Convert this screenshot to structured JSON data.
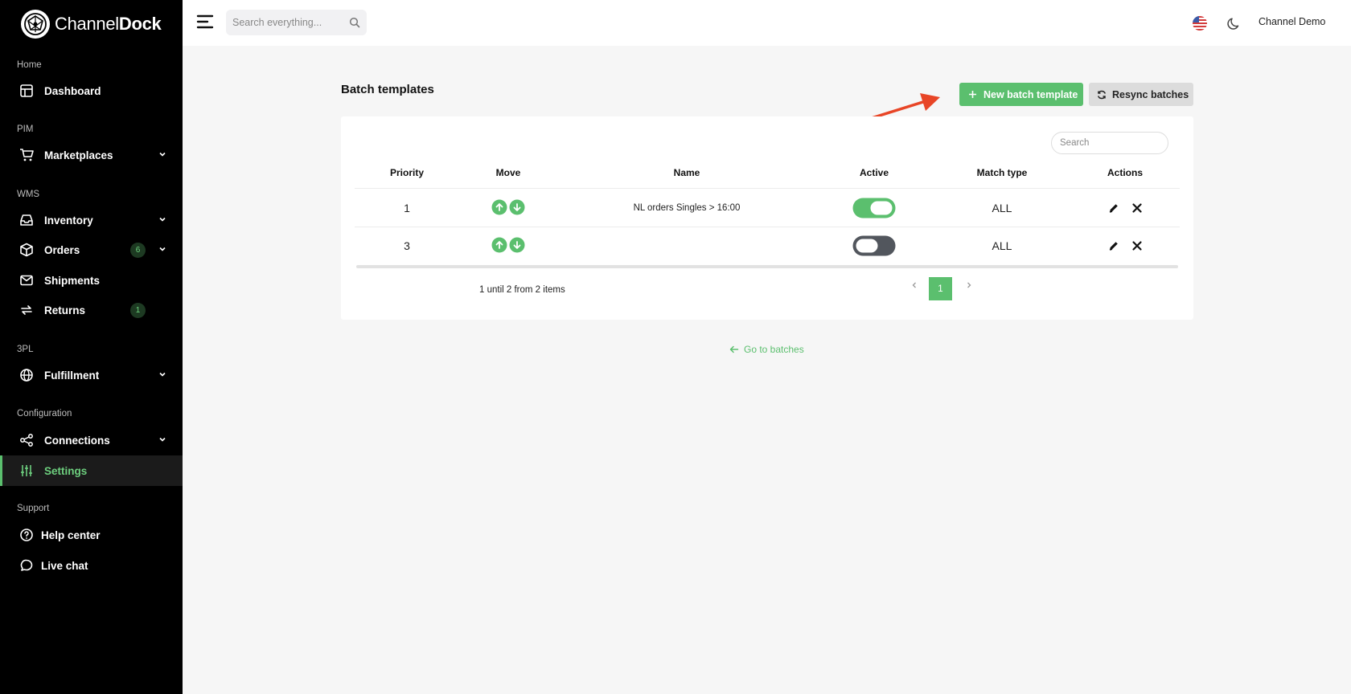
{
  "brand": {
    "name_light": "Channel",
    "name_bold": "Dock",
    "accent": "#5bbf6e"
  },
  "topbar": {
    "search_placeholder": "Search everything...",
    "user": "Channel Demo"
  },
  "sidebar": {
    "sections": {
      "home": "Home",
      "pim": "PIM",
      "wms": "WMS",
      "threepl": "3PL",
      "configuration": "Configuration",
      "support": "Support"
    },
    "items": {
      "dashboard": {
        "label": "Dashboard",
        "icon": "dashboard-icon"
      },
      "marketplaces": {
        "label": "Marketplaces",
        "icon": "cart-icon"
      },
      "inventory": {
        "label": "Inventory",
        "icon": "inbox-icon"
      },
      "orders": {
        "label": "Orders",
        "icon": "box-icon",
        "badge": "6"
      },
      "shipments": {
        "label": "Shipments",
        "icon": "mail-icon"
      },
      "returns": {
        "label": "Returns",
        "icon": "return-icon",
        "badge": "1"
      },
      "fulfillment": {
        "label": "Fulfillment",
        "icon": "globe-icon"
      },
      "connections": {
        "label": "Connections",
        "icon": "share-icon"
      },
      "settings": {
        "label": "Settings",
        "icon": "sliders-icon",
        "active": true
      },
      "help": {
        "label": "Help center",
        "icon": "help-icon"
      },
      "chat": {
        "label": "Live chat",
        "icon": "chat-icon"
      }
    }
  },
  "page": {
    "title": "Batch templates",
    "new_button": "New batch template",
    "resync_button": "Resync batches",
    "back_link": "Go to batches"
  },
  "table": {
    "search_placeholder": "Search",
    "columns": {
      "priority": "Priority",
      "move": "Move",
      "name": "Name",
      "active": "Active",
      "match_type": "Match type",
      "actions": "Actions"
    },
    "rows": [
      {
        "priority": "1",
        "name": "NL orders Singles > 16:00",
        "active": true,
        "match_type": "ALL"
      },
      {
        "priority": "3",
        "name": "",
        "active": false,
        "match_type": "ALL"
      }
    ],
    "summary": "1 until 2 from 2 items",
    "current_page": "1"
  },
  "annotation": {
    "arrow_color": "#e84526"
  }
}
